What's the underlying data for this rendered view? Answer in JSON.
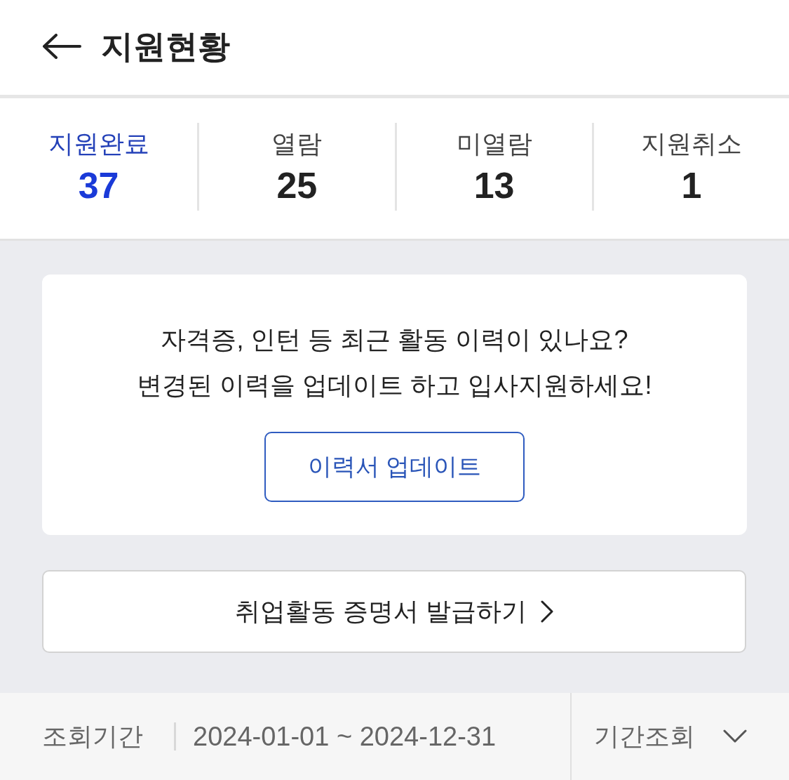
{
  "header": {
    "title": "지원현황"
  },
  "stats": [
    {
      "label": "지원완료",
      "count": "37",
      "selected": true
    },
    {
      "label": "열람",
      "count": "25",
      "selected": false
    },
    {
      "label": "미열람",
      "count": "13",
      "selected": false
    },
    {
      "label": "지원취소",
      "count": "1",
      "selected": false
    }
  ],
  "promo": {
    "lines": [
      "자격증, 인턴 등 최근 활동 이력이 있나요?",
      "변경된 이력을 업데이트 하고 입사지원하세요!"
    ],
    "button": "이력서 업데이트"
  },
  "certificate_button": "취업활동 증명서 발급하기",
  "period_filter": {
    "label": "조회기간",
    "range": "2024-01-01 ~ 2024-12-31",
    "dropdown": "기간조회"
  }
}
